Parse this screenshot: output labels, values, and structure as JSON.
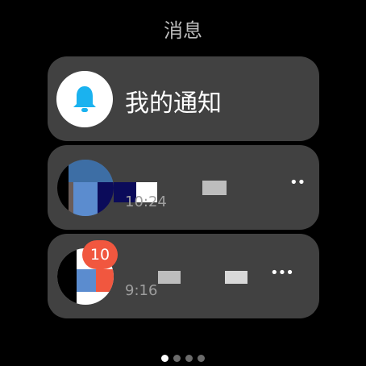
{
  "header": {
    "title": "消息"
  },
  "notifications_entry": {
    "label": "我的通知",
    "icon": "bell-icon",
    "icon_color": "#1ab2ef"
  },
  "messages": [
    {
      "time": "10:24",
      "more_icon": "more-icon"
    },
    {
      "time": "9:16",
      "badge": "10",
      "more_icon": "more-icon"
    }
  ],
  "pager": {
    "pages": 4,
    "current": 1
  },
  "colors": {
    "background": "#000000",
    "card": "#414141",
    "badge": "#f1573f",
    "accent": "#1ab2ef"
  }
}
